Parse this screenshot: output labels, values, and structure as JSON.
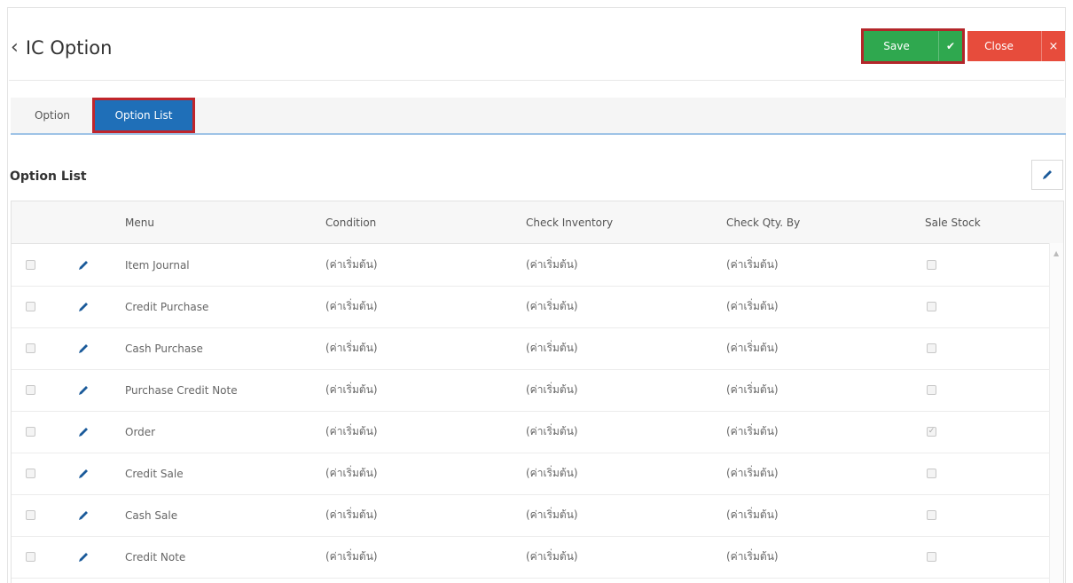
{
  "header": {
    "title": "IC Option",
    "back_icon": "chevron-left-icon",
    "save_label": "Save",
    "save_icon": "check-icon",
    "close_label": "Close",
    "close_icon": "x-icon",
    "colors": {
      "save": "#2fa84f",
      "close": "#e74c3c",
      "highlight": "#c0252b"
    }
  },
  "tabs": [
    {
      "label": "Option",
      "active": false
    },
    {
      "label": "Option List",
      "active": true
    }
  ],
  "section": {
    "title": "Option List",
    "edit_icon": "pencil-icon"
  },
  "table": {
    "columns": [
      "Menu",
      "Condition",
      "Check Inventory",
      "Check Qty. By",
      "Sale Stock"
    ],
    "rows": [
      {
        "menu": "Item Journal",
        "condition": "(ค่าเริ่มต้น)",
        "check_inventory": "(ค่าเริ่มต้น)",
        "check_qty_by": "(ค่าเริ่มต้น)",
        "sale_stock": false
      },
      {
        "menu": "Credit Purchase",
        "condition": "(ค่าเริ่มต้น)",
        "check_inventory": "(ค่าเริ่มต้น)",
        "check_qty_by": "(ค่าเริ่มต้น)",
        "sale_stock": false
      },
      {
        "menu": "Cash Purchase",
        "condition": "(ค่าเริ่มต้น)",
        "check_inventory": "(ค่าเริ่มต้น)",
        "check_qty_by": "(ค่าเริ่มต้น)",
        "sale_stock": false
      },
      {
        "menu": "Purchase Credit Note",
        "condition": "(ค่าเริ่มต้น)",
        "check_inventory": "(ค่าเริ่มต้น)",
        "check_qty_by": "(ค่าเริ่มต้น)",
        "sale_stock": false
      },
      {
        "menu": "Order",
        "condition": "(ค่าเริ่มต้น)",
        "check_inventory": "(ค่าเริ่มต้น)",
        "check_qty_by": "(ค่าเริ่มต้น)",
        "sale_stock": true
      },
      {
        "menu": "Credit Sale",
        "condition": "(ค่าเริ่มต้น)",
        "check_inventory": "(ค่าเริ่มต้น)",
        "check_qty_by": "(ค่าเริ่มต้น)",
        "sale_stock": false
      },
      {
        "menu": "Cash Sale",
        "condition": "(ค่าเริ่มต้น)",
        "check_inventory": "(ค่าเริ่มต้น)",
        "check_qty_by": "(ค่าเริ่มต้น)",
        "sale_stock": false
      },
      {
        "menu": "Credit Note",
        "condition": "(ค่าเริ่มต้น)",
        "check_inventory": "(ค่าเริ่มต้น)",
        "check_qty_by": "(ค่าเริ่มต้น)",
        "sale_stock": false
      }
    ]
  }
}
